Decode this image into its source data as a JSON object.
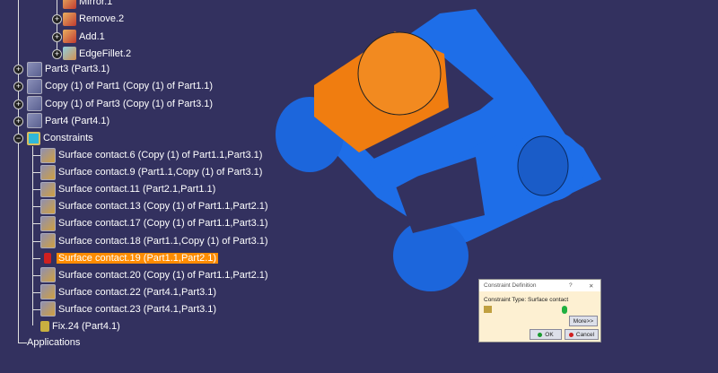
{
  "tree": {
    "features": [
      "Mirror.1",
      "Remove.2",
      "Add.1",
      "EdgeFillet.2"
    ],
    "parts": [
      "Part3 (Part3.1)",
      "Copy (1) of Part1 (Copy (1) of Part1.1)",
      "Copy (1) of Part3 (Copy (1) of Part3.1)",
      "Part4 (Part4.1)"
    ],
    "constraints_label": "Constraints",
    "constraints": [
      "Surface contact.6 (Copy (1) of Part1.1,Part3.1)",
      "Surface contact.9 (Part1.1,Copy (1) of Part3.1)",
      "Surface contact.11 (Part2.1,Part1.1)",
      "Surface contact.13 (Copy (1) of Part1.1,Part2.1)",
      "Surface contact.17 (Copy (1) of Part1.1,Part3.1)",
      "Surface contact.18 (Part1.1,Copy (1) of Part3.1)",
      "Surface contact.19 (Part1.1,Part2.1)",
      "Surface contact.20 (Copy (1) of Part1.1,Part2.1)",
      "Surface contact.22 (Part4.1,Part3.1)",
      "Surface contact.23 (Part4.1,Part3.1)"
    ],
    "selected_index": 6,
    "fix": "Fix.24 (Part4.1)",
    "applications": "Applications"
  },
  "dialog": {
    "title": "Constraint Definition",
    "help": "?",
    "close": "✕",
    "type_text": "Constraint Type: Surface contact",
    "more": "More>>",
    "ok": "OK",
    "cancel": "Cancel"
  },
  "colors": {
    "background": "#33315f",
    "selected": "#ff8c00",
    "part_blue": "#1e6ee8",
    "part_orange": "#f07d10"
  }
}
